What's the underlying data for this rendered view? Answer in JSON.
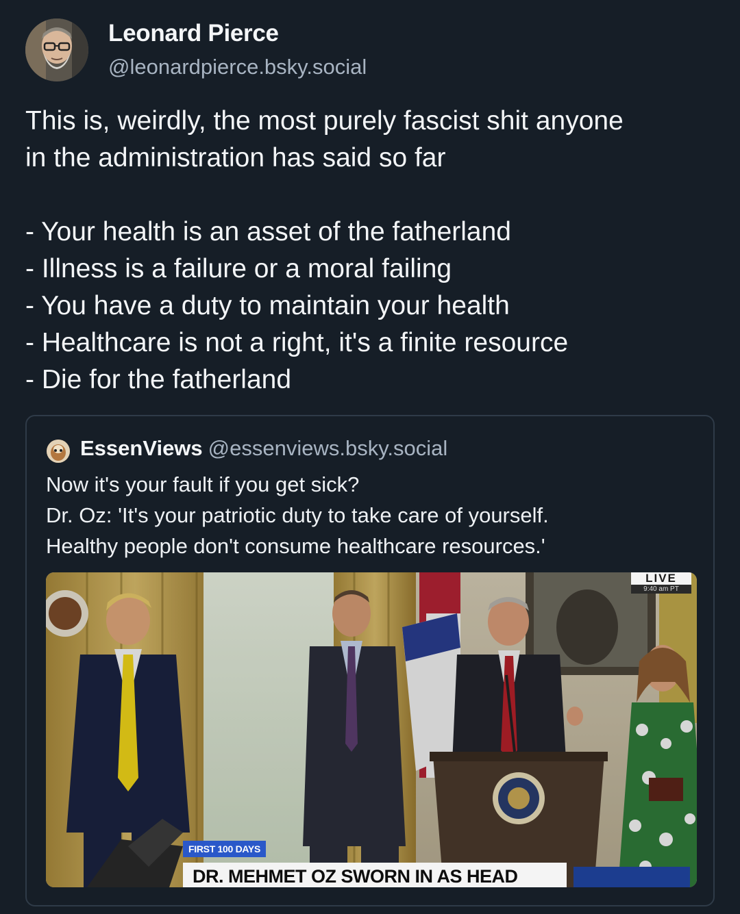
{
  "post": {
    "author_name": "Leonard Pierce",
    "author_handle": "@leonardpierce.bsky.social",
    "text_lines": [
      "This is, weirdly, the most purely fascist shit anyone",
      "in the administration has said so far",
      "",
      "- Your health is an asset of the fatherland",
      "- Illness is a failure or a moral failing",
      "- You have a duty to maintain your health",
      "- Healthcare is not a right, it's a finite resource",
      "- Die for the fatherland"
    ]
  },
  "quote": {
    "author_name": "EssenViews",
    "author_handle": "@essenviews.bsky.social",
    "text_lines": [
      "Now it's your fault if you get sick?",
      "Dr. Oz:  'It's your patriotic duty to take care of yourself.",
      "Healthy people don't consume healthcare resources.'"
    ],
    "media": {
      "live_label": "LIVE",
      "live_time": "9:40 am PT",
      "chyron_tag": "FIRST 100 DAYS",
      "chyron_headline": "DR. MEHMET OZ SWORN IN AS HEAD"
    }
  },
  "colors": {
    "background": "#161e27",
    "text": "#f1f3f5",
    "muted": "#a8b4c2",
    "quote_border": "#2f3b48",
    "chyron_tag": "#2a58c9"
  }
}
